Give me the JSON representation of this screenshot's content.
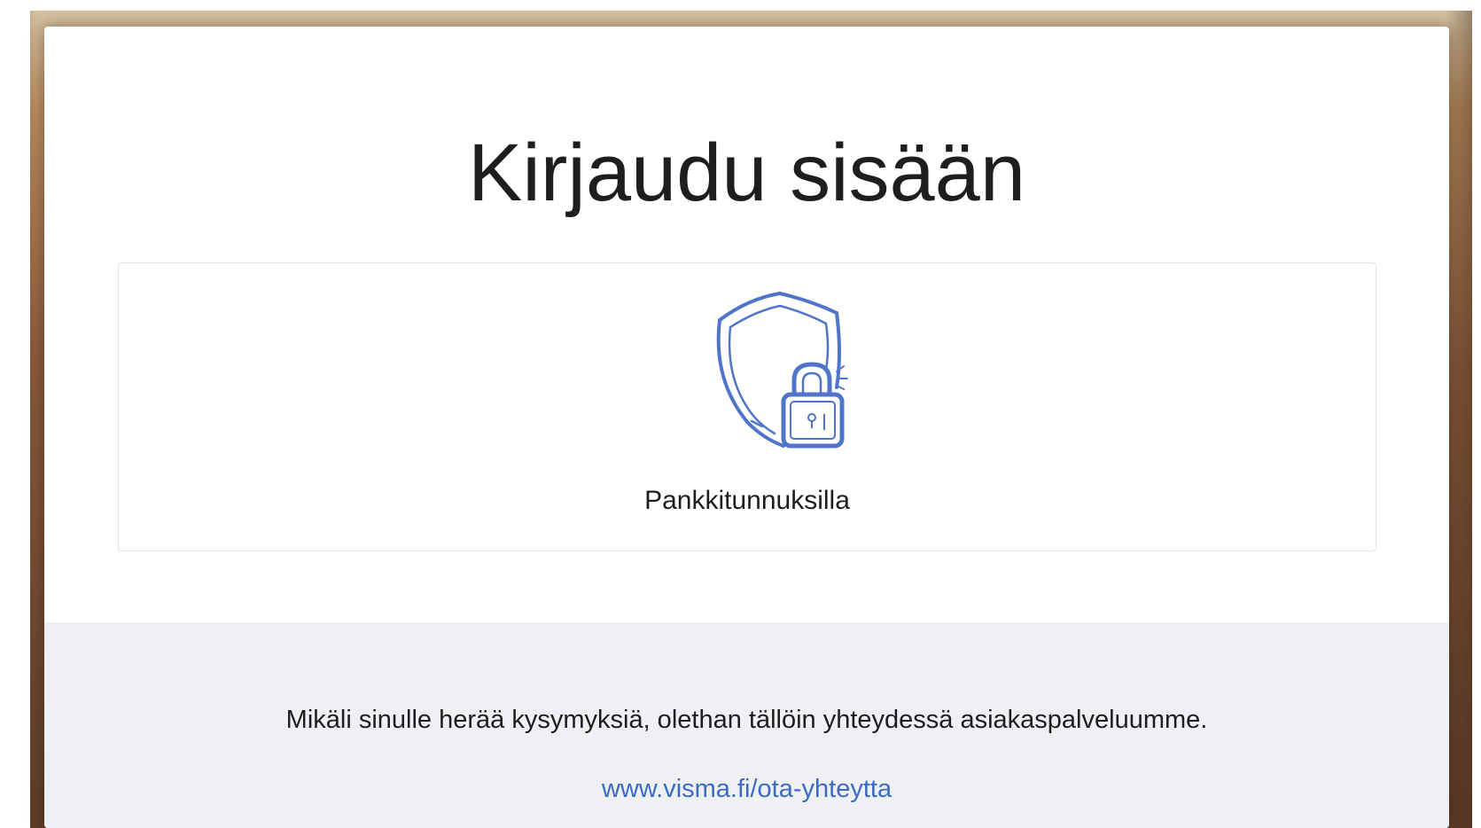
{
  "login": {
    "title": "Kirjaudu sisään",
    "option": {
      "label": "Pankkitunnuksilla",
      "icon": "shield-lock-icon"
    }
  },
  "footer": {
    "text": "Mikäli sinulle herää kysymyksiä, olethan tällöin yhteydessä asiakaspalveluumme.",
    "link_text": "www.visma.fi/ota-yhteytta"
  },
  "colors": {
    "accent": "#4f74c9",
    "link": "#3b6bc3",
    "footer_bg": "#eef0f4",
    "text": "#1e1e1e"
  }
}
